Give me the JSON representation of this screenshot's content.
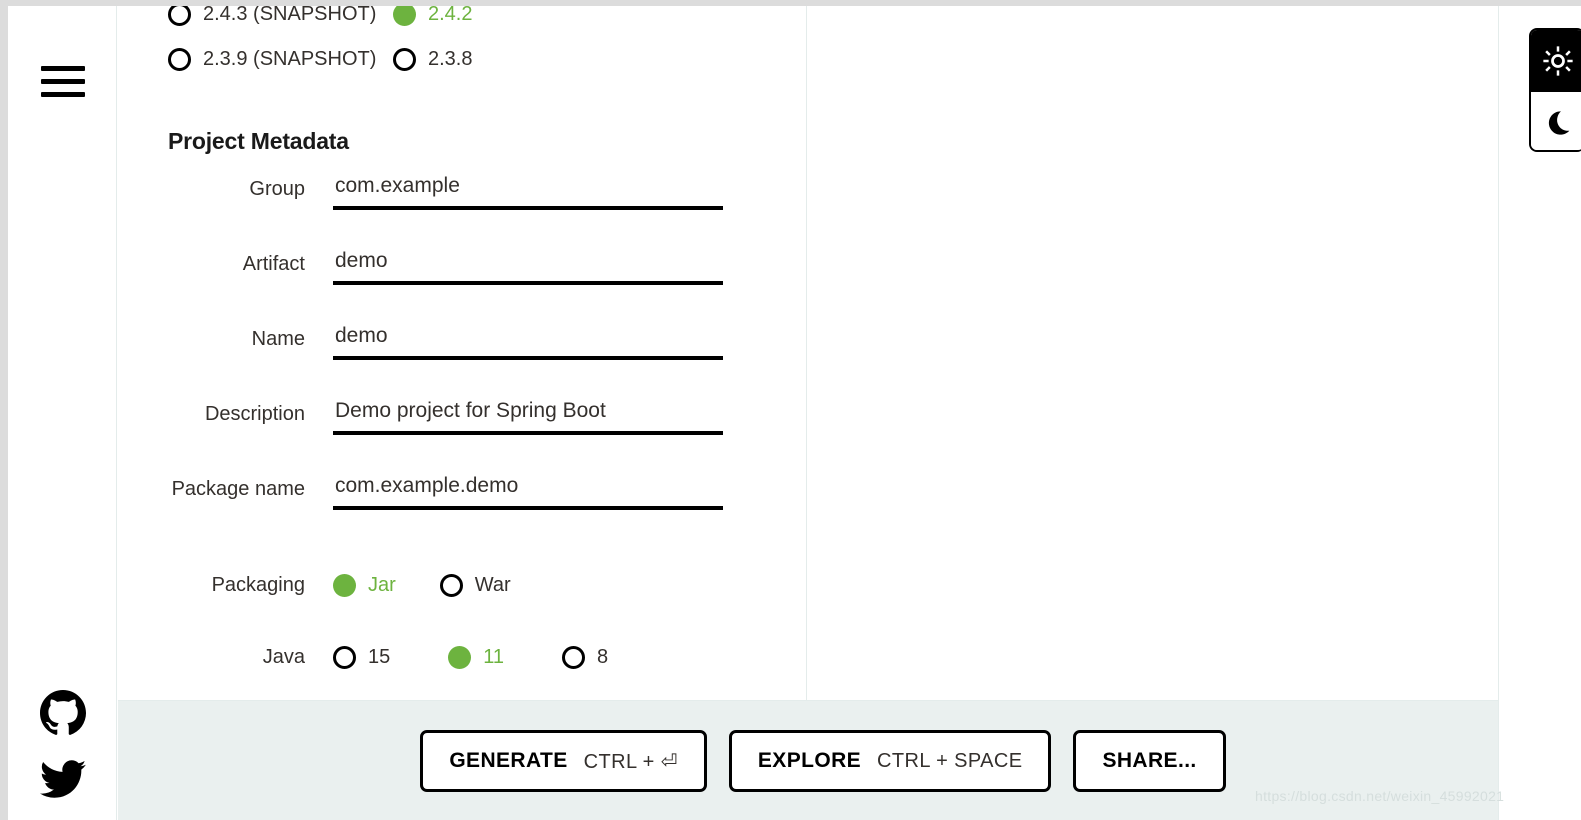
{
  "accent_green": "#6db33f",
  "footer_bg": "#eaf0ef",
  "rail": {
    "menu_icon": "hamburger-menu-icon",
    "social": [
      {
        "icon": "github-icon",
        "label": "GitHub"
      },
      {
        "icon": "twitter-icon",
        "label": "Twitter"
      }
    ]
  },
  "theme_toggle": {
    "light_icon": "sun-icon",
    "dark_icon": "moon-icon",
    "active": "light"
  },
  "spring_boot_versions": [
    [
      {
        "label": "2.4.3 (SNAPSHOT)",
        "selected": false
      },
      {
        "label": "2.4.2",
        "selected": true
      }
    ],
    [
      {
        "label": "2.3.9 (SNAPSHOT)",
        "selected": false
      },
      {
        "label": "2.3.8",
        "selected": false
      }
    ]
  ],
  "project_metadata": {
    "title": "Project Metadata",
    "fields": [
      {
        "label": "Group",
        "value": "com.example",
        "placeholder": "com.example"
      },
      {
        "label": "Artifact",
        "value": "demo",
        "placeholder": "demo"
      },
      {
        "label": "Name",
        "value": "demo",
        "placeholder": "demo"
      },
      {
        "label": "Description",
        "value": "Demo project for Spring Boot",
        "placeholder": "Demo project for Spring Boot"
      },
      {
        "label": "Package name",
        "value": "com.example.demo",
        "placeholder": "com.example.demo"
      }
    ],
    "packaging": {
      "label": "Packaging",
      "options": [
        {
          "label": "Jar",
          "selected": true
        },
        {
          "label": "War",
          "selected": false
        }
      ]
    },
    "java": {
      "label": "Java",
      "options": [
        {
          "label": "15",
          "selected": false
        },
        {
          "label": "11",
          "selected": true
        },
        {
          "label": "8",
          "selected": false
        }
      ]
    }
  },
  "footer": {
    "buttons": [
      {
        "primary": "GENERATE",
        "hint": "CTRL + ⏎"
      },
      {
        "primary": "EXPLORE",
        "hint": "CTRL + SPACE"
      },
      {
        "primary": "SHARE...",
        "hint": ""
      }
    ]
  },
  "watermark": "https://blog.csdn.net/weixin_45992021"
}
